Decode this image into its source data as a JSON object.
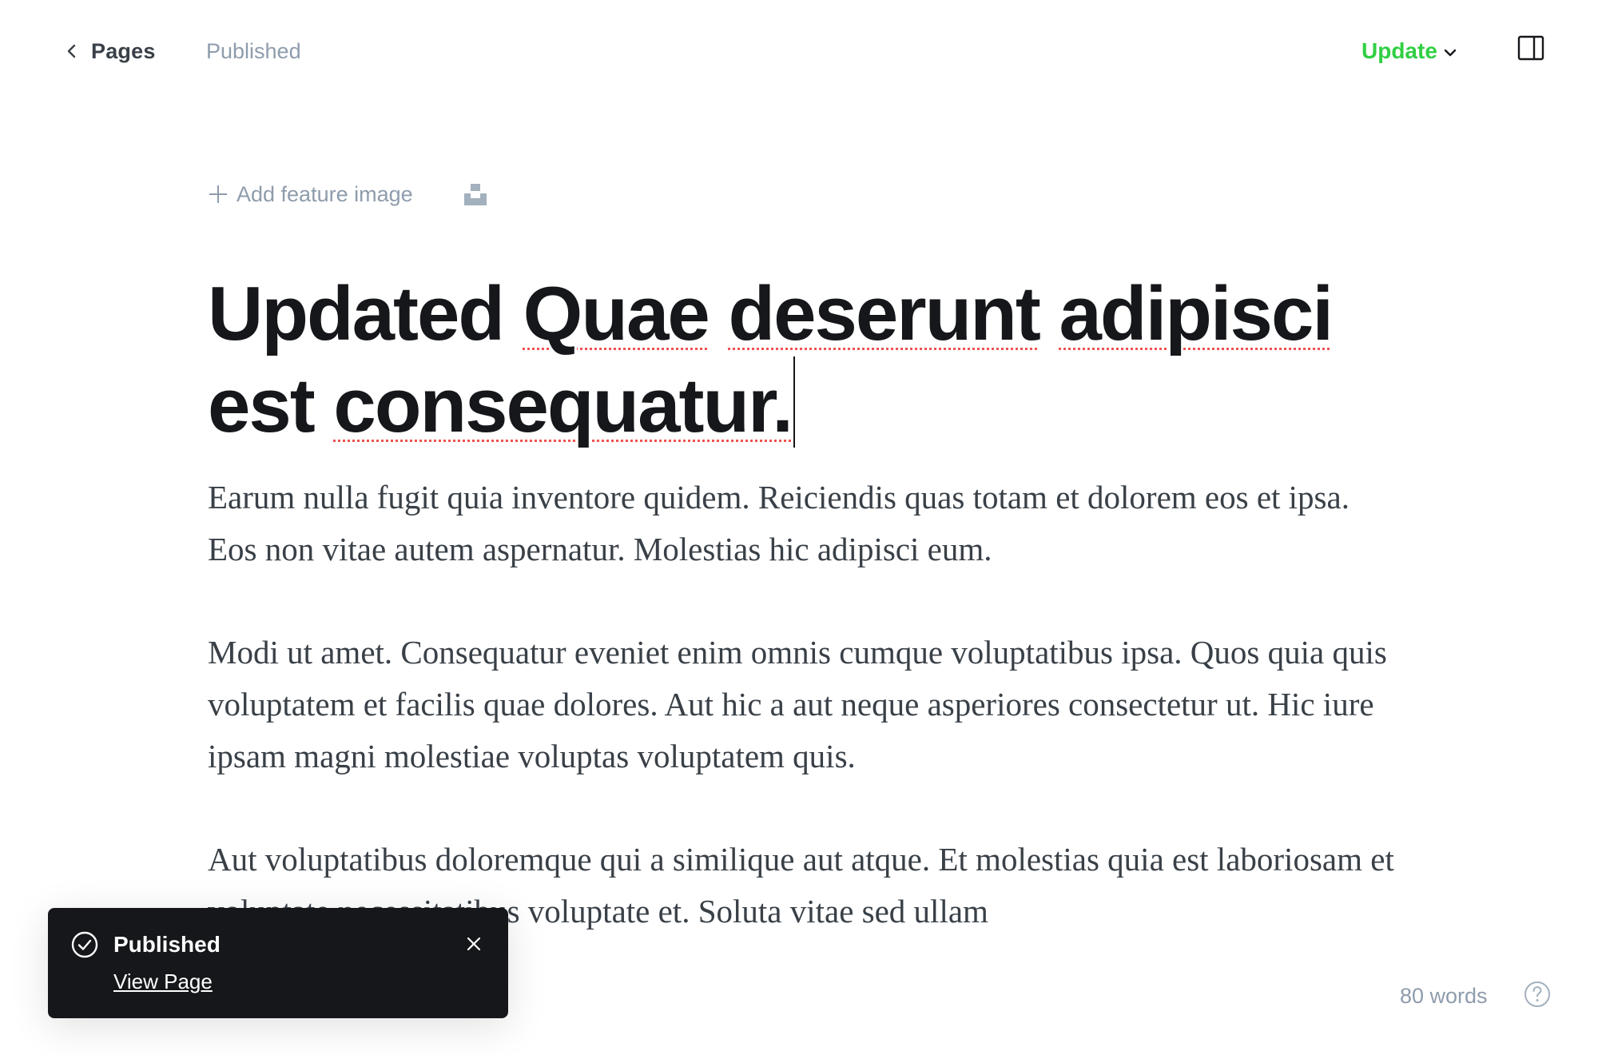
{
  "header": {
    "back_label": "Pages",
    "status": "Published",
    "update_label": "Update",
    "icons": {
      "back": "chevron-left-icon",
      "update_menu": "chevron-down-icon",
      "sidebar": "sidebar-toggle-icon"
    }
  },
  "editor": {
    "add_feature_image_label": "Add feature image",
    "title_words": [
      "Updated",
      "Quae",
      "deserunt",
      "adipisci",
      "est",
      "consequatur."
    ],
    "paragraphs": [
      "Earum nulla fugit quia inventore quidem. Reiciendis quas totam et dolorem eos et ipsa. Eos non vitae autem aspernatur. Molestias hic adipisci eum.",
      "Modi ut amet. Consequatur eveniet enim omnis cumque voluptatibus ipsa. Quos quia quis voluptatem et facilis quae dolores. Aut hic a aut neque asperiores consectetur ut. Hic iure ipsam magni molestiae voluptas voluptatem quis.",
      "Aut voluptatibus doloremque qui a similique aut atque. Et molestias quia est laboriosam et voluptate necessitatibus voluptate et. Soluta vitae sed ullam"
    ]
  },
  "footer": {
    "word_count": "80 words"
  },
  "toast": {
    "title": "Published",
    "link_label": "View Page"
  },
  "colors": {
    "accent_green": "#30cf43",
    "toast_bg": "#15171a",
    "muted_text": "#8e9cac",
    "spellcheck": "#f05151"
  }
}
